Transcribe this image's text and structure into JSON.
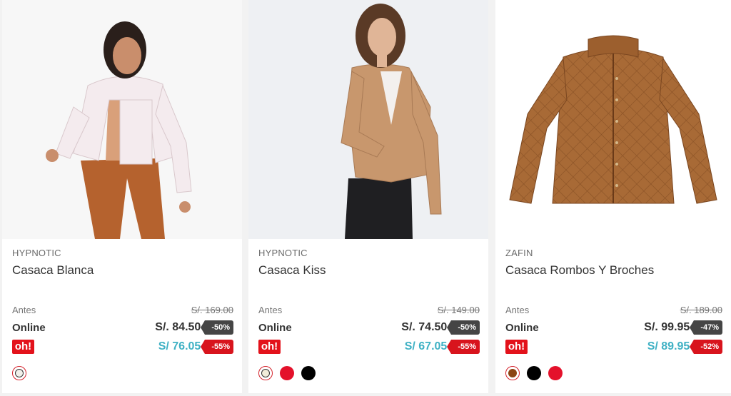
{
  "products": [
    {
      "brand": "HYPNOTIC",
      "name": "Casaca Blanca",
      "image_icon": "model-white-jacket-photo",
      "antes_label": "Antes",
      "antes_price": "S/. 169.00",
      "online_label": "Online",
      "online_price": "S/. 84.50",
      "online_discount": "-50%",
      "oh_label": "oh!",
      "oh_price": "S/ 76.05",
      "oh_discount": "-55%",
      "swatches": [
        "#f2f0ea"
      ]
    },
    {
      "brand": "HYPNOTIC",
      "name": "Casaca Kiss",
      "image_icon": "model-tan-leather-jacket-photo",
      "antes_label": "Antes",
      "antes_price": "S/. 149.00",
      "online_label": "Online",
      "online_price": "S/. 74.50",
      "online_discount": "-50%",
      "oh_label": "oh!",
      "oh_price": "S/ 67.05",
      "oh_discount": "-55%",
      "swatches": [
        "#f1ecd9",
        "#e4112b",
        "#000000"
      ]
    },
    {
      "brand": "ZAFIN",
      "name": "Casaca Rombos Y Broches",
      "image_icon": "brown-quilted-jacket-photo",
      "antes_label": "Antes",
      "antes_price": "S/. 189.00",
      "online_label": "Online",
      "online_price": "S/. 99.95",
      "online_discount": "-47%",
      "oh_label": "oh!",
      "oh_price": "S/ 89.95",
      "oh_discount": "-52%",
      "swatches": [
        "#8b4513",
        "#000000",
        "#e4112b"
      ]
    }
  ],
  "colors": {
    "oh_brand": "#e3121b",
    "oh_price": "#3fb1c4",
    "online_badge": "#454545",
    "oh_badge": "#d8141d"
  }
}
